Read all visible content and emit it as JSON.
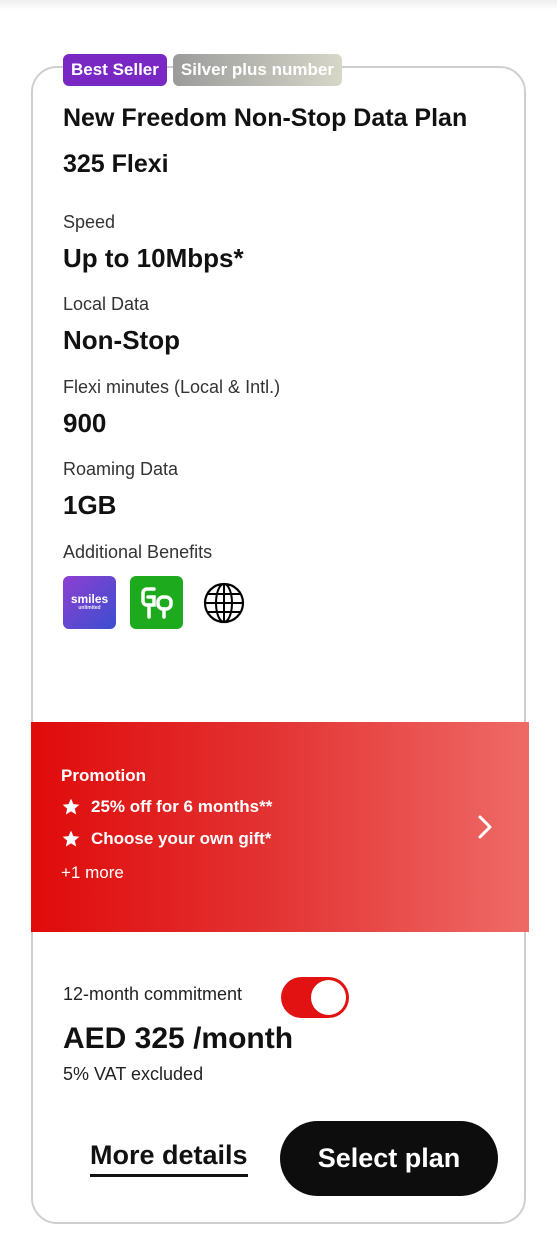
{
  "badges": {
    "best_seller": "Best Seller",
    "silver": "Silver plus number"
  },
  "plan": {
    "title": "New Freedom Non-Stop Data Plan",
    "name": "325 Flexi"
  },
  "specs": [
    {
      "label": "Speed",
      "value": "Up to 10Mbps*"
    },
    {
      "label": "Local Data",
      "value": "Non-Stop"
    },
    {
      "label": "Flexi minutes (Local & Intl.)",
      "value": "900"
    },
    {
      "label": "Roaming Data",
      "value": "1GB"
    }
  ],
  "benefits": {
    "label": "Additional Benefits",
    "smiles_text": "smiles",
    "smiles_sub": "unlimited",
    "icons": [
      "smiles-logo-icon",
      "go-app-icon",
      "globe-icon"
    ]
  },
  "promotion": {
    "title": "Promotion",
    "items": [
      "25% off for 6 months**",
      "Choose your own gift*"
    ],
    "more": "+1 more"
  },
  "pricing": {
    "commitment_label": "12-month commitment",
    "commitment_on": true,
    "price": "AED 325 /month",
    "vat_note": "5% VAT excluded"
  },
  "actions": {
    "more_details": "More details",
    "select_plan": "Select plan"
  },
  "colors": {
    "accent_red": "#e21212",
    "badge_purple": "#7a28c4",
    "button_dark": "#0d0d0d"
  }
}
